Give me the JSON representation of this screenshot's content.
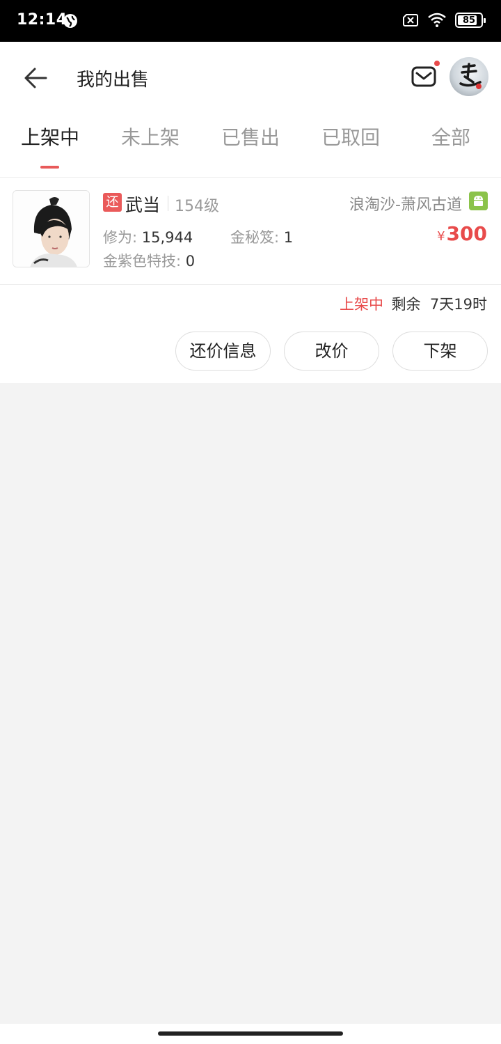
{
  "status_bar": {
    "time": "12:14",
    "battery": "85",
    "battery_level": 0.85,
    "icons": [
      "globe-icon",
      "sim-off-icon",
      "wifi-icon",
      "battery-icon"
    ]
  },
  "app_bar": {
    "title": "我的出售",
    "back_icon": "arrow-left-icon",
    "mail_icon": "mail-icon",
    "notification_dot_color": "#e84b4b"
  },
  "tabs": [
    {
      "label": "上架中",
      "active": true
    },
    {
      "label": "未上架",
      "active": false
    },
    {
      "label": "已售出",
      "active": false
    },
    {
      "label": "已取回",
      "active": false
    },
    {
      "label": "全部",
      "active": false
    }
  ],
  "listing": {
    "tag": "还",
    "school": "武当",
    "level": "154级",
    "server": "浪淘沙-萧风古道",
    "platform_icon": "android-icon",
    "stats": {
      "cultivation_label": "修为:",
      "cultivation_value": "15,944",
      "gold_book_label": "金秘笈:",
      "gold_book_value": "1",
      "skill_label": "金紫色特技:",
      "skill_value": "0"
    },
    "price_symbol": "¥",
    "price": "300",
    "status": "上架中",
    "remaining": "剩余  7天19时",
    "buttons": {
      "counter_offer": "还价信息",
      "change_price": "改价",
      "delist": "下架"
    }
  },
  "colors": {
    "accent": "#e84b4b",
    "background": "#f3f3f3",
    "android": "#8bc34a"
  }
}
